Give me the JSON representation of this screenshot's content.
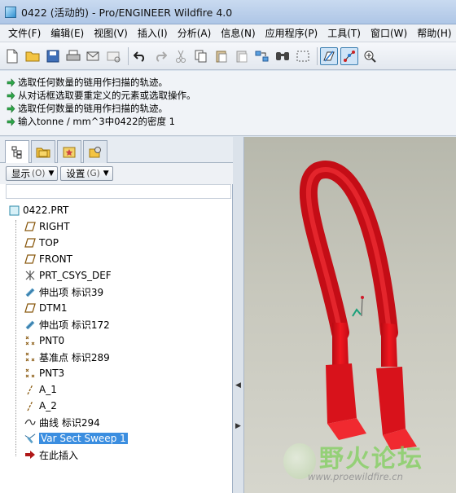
{
  "window": {
    "title": "0422 (活动的) - Pro/ENGINEER Wildfire 4.0"
  },
  "menu": [
    "文件(F)",
    "编辑(E)",
    "视图(V)",
    "插入(I)",
    "分析(A)",
    "信息(N)",
    "应用程序(P)",
    "工具(T)",
    "窗口(W)",
    "帮助(H)"
  ],
  "toolbar_icons": [
    "new-file-icon",
    "open-folder-icon",
    "save-icon",
    "print-icon",
    "email-icon",
    "email-link-icon",
    "undo-icon",
    "redo-icon",
    "cut-icon",
    "copy-icon",
    "paste-icon",
    "paste-special-icon",
    "regenerate-icon",
    "find-icon",
    "selection-box-icon",
    "datum-plane-display-icon",
    "datum-axis-display-icon",
    "zoom-in-icon"
  ],
  "messages": [
    "选取任何数量的链用作扫描的轨迹。",
    "从对话框选取要重定义的元素或选取操作。",
    "选取任何数量的链用作扫描的轨迹。",
    "输入tonne / mm^3中0422的密度   1"
  ],
  "panel": {
    "show_label": "显示",
    "show_accel": "(O)",
    "settings_label": "设置",
    "settings_accel": "(G)"
  },
  "tree": {
    "root": "0422.PRT",
    "items": [
      {
        "label": "RIGHT",
        "icon": "datum-plane-icon"
      },
      {
        "label": "TOP",
        "icon": "datum-plane-icon"
      },
      {
        "label": "FRONT",
        "icon": "datum-plane-icon"
      },
      {
        "label": "PRT_CSYS_DEF",
        "icon": "coordinate-system-icon"
      },
      {
        "label": "伸出项 标识39",
        "icon": "protrusion-icon"
      },
      {
        "label": "DTM1",
        "icon": "datum-plane-icon"
      },
      {
        "label": "伸出项 标识172",
        "icon": "protrusion-icon"
      },
      {
        "label": "PNT0",
        "icon": "datum-point-icon"
      },
      {
        "label": "基准点 标识289",
        "icon": "datum-point-icon"
      },
      {
        "label": "PNT3",
        "icon": "datum-point-icon"
      },
      {
        "label": "A_1",
        "icon": "datum-axis-icon"
      },
      {
        "label": "A_2",
        "icon": "datum-axis-icon"
      },
      {
        "label": "曲线 标识294",
        "icon": "curve-icon"
      },
      {
        "label": "Var Sect Sweep 1",
        "icon": "var-sect-sweep-icon",
        "selected": true
      },
      {
        "label": "在此插入",
        "icon": "insert-here-arrow-icon"
      }
    ]
  },
  "watermark": {
    "text": "野火论坛",
    "url": "www.proewildfire.cn"
  },
  "colors": {
    "model": "#e8101a",
    "selection": "#3b8ee0",
    "viewport_bg": "#c4c4b8"
  }
}
